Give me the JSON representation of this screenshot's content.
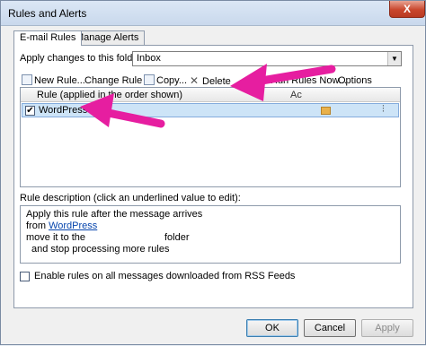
{
  "window": {
    "title": "Rules and Alerts",
    "close_glyph": "X"
  },
  "tabs": [
    {
      "label": "E-mail Rules",
      "active": true
    },
    {
      "label": "Manage Alerts",
      "active": false
    }
  ],
  "apply_folder": {
    "label": "Apply changes to this folder:",
    "value": "Inbox"
  },
  "toolbar": {
    "new_rule": "New Rule...",
    "change_rule": "Change Rule",
    "copy": "Copy...",
    "delete": "Delete",
    "run_rules": "Run Rules Now...",
    "options": "Options"
  },
  "rules_list": {
    "column_header": "Rule (applied in the order shown)",
    "column_header_2": "Ac",
    "rows": [
      {
        "name": "WordPress",
        "checked": true,
        "selected": true
      }
    ]
  },
  "description": {
    "label": "Rule description (click an underlined value to edit):",
    "line1": "Apply this rule after the message arrives",
    "line2_prefix": "from ",
    "line2_link": "WordPress",
    "line3_prefix": "move it to the",
    "line3_suffix": "folder",
    "line4": "and stop processing more rules"
  },
  "rss": {
    "label": "Enable rules on all messages downloaded from RSS Feeds",
    "checked": false
  },
  "buttons": {
    "ok": "OK",
    "cancel": "Cancel",
    "apply": "Apply"
  },
  "colors": {
    "annotation_arrow": "#e61ea0",
    "selection": "#cde4f7"
  },
  "icons": [
    "new-rule-icon",
    "change-rule-icon",
    "copy-icon",
    "delete-icon",
    "run-rules-icon",
    "folder-icon",
    "rule-actions-icon"
  ]
}
